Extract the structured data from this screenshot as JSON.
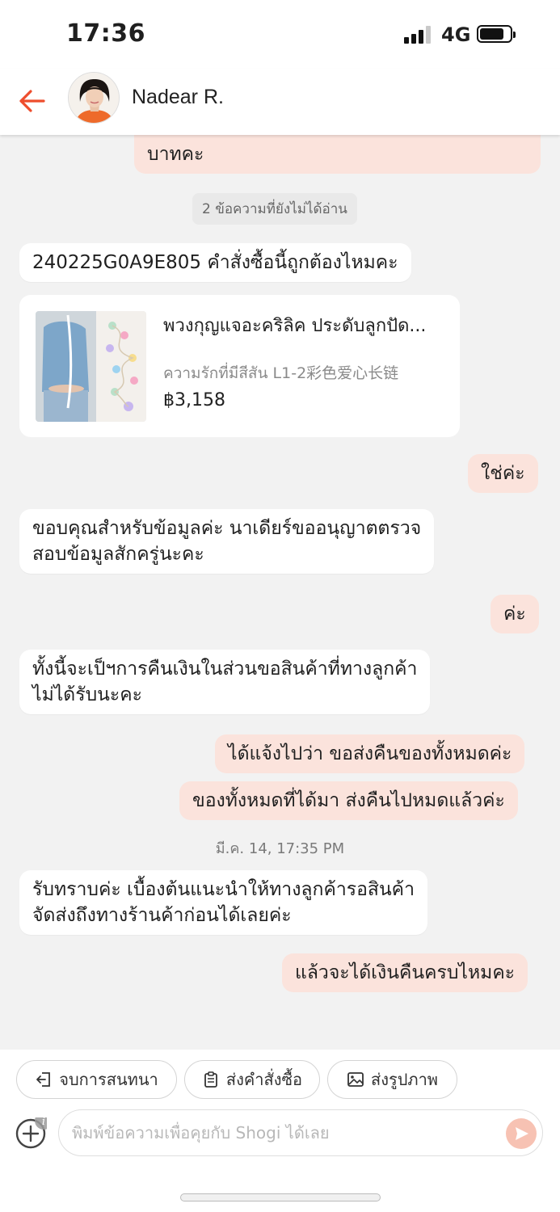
{
  "status_bar": {
    "time": "17:36",
    "network": "4G",
    "battery_level": 0.8
  },
  "header": {
    "contact_name": "Nadear R."
  },
  "messages": [
    {
      "direction": "out",
      "text": "บาทคะ"
    },
    {
      "type": "unread_divider",
      "text": "2 ข้อความที่ยังไม่ได้อ่าน"
    },
    {
      "direction": "in",
      "text": "240225G0A9E805 คำสั่งซื้อนี้ถูกต้องไหมคะ"
    },
    {
      "type": "product",
      "title": "พวงกุญแจอะคริลิค ประดับลูกปัด...",
      "variant": "ความรักที่มีสีสัน L1-2彩色爱心长链",
      "price": "฿3,158"
    },
    {
      "direction": "out",
      "text": "ใช่ค่ะ"
    },
    {
      "direction": "in",
      "lines": [
        "ขอบคุณสำหรับข้อมูลค่ะ นาเดียร์ขออนุญาตตรวจ",
        "สอบข้อมูลสักครู่นะคะ"
      ]
    },
    {
      "direction": "out",
      "text": "ค่ะ"
    },
    {
      "direction": "in",
      "lines": [
        "ทั้งนี้จะเป็ฯการคืนเงินในส่วนขอสินค้าที่ทางลูกค้า",
        "ไม่ได้รับนะคะ"
      ]
    },
    {
      "direction": "out",
      "text": "ได้แจ้งไปว่า ขอส่งคืนของทั้งหมดค่ะ"
    },
    {
      "direction": "out",
      "text": "ของทั้งหมดที่ได้มา ส่งคืนไปหมดแล้วค่ะ"
    },
    {
      "type": "timestamp",
      "text": "มี.ค. 14, 17:35 PM"
    },
    {
      "direction": "in",
      "lines": [
        "รับทราบค่ะ เบื้องต้นแนะนำให้ทางลูกค้ารอสินค้า",
        "จัดส่งถึงทางร้านค้าก่อนได้เลยค่ะ"
      ]
    },
    {
      "direction": "out",
      "text": "แล้วจะได้เงินคืนครบไหมคะ"
    }
  ],
  "actions": [
    {
      "label": "จบการสนทนา",
      "icon": "exit-icon"
    },
    {
      "label": "ส่งคำสั่งซื้อ",
      "icon": "clipboard-icon"
    },
    {
      "label": "ส่งรูปภาพ",
      "icon": "image-icon"
    }
  ],
  "composer": {
    "placeholder": "พิมพ์ข้อความเพื่อคุยกับ Shogi ได้เลย"
  },
  "colors": {
    "accent": "#ee4d2d",
    "outgoing_bubble": "#fbe3dc",
    "incoming_bubble": "#ffffff",
    "send_button": "#f7c2b3"
  }
}
